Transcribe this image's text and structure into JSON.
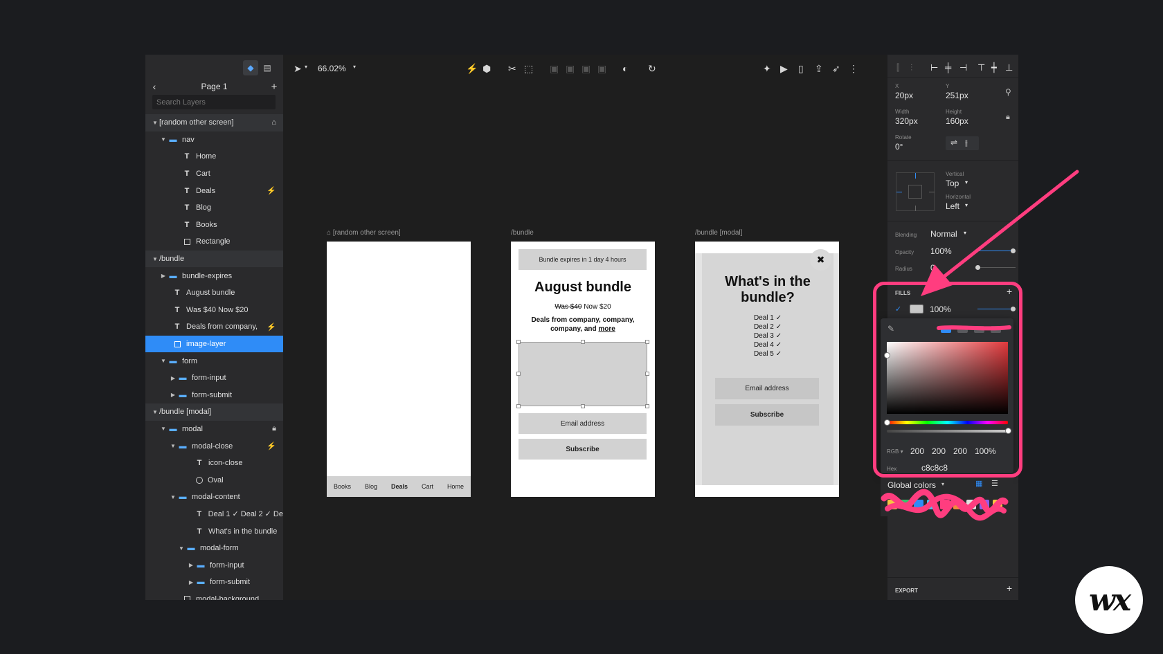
{
  "layers_panel": {
    "page_title": "Page 1",
    "search_placeholder": "Search Layers",
    "items": [
      {
        "label": "[random other screen]",
        "type": "section"
      },
      {
        "label": "nav",
        "type": "folder"
      },
      {
        "label": "Home",
        "type": "text"
      },
      {
        "label": "Cart",
        "type": "text"
      },
      {
        "label": "Deals",
        "type": "text"
      },
      {
        "label": "Blog",
        "type": "text"
      },
      {
        "label": "Books",
        "type": "text"
      },
      {
        "label": "Rectangle",
        "type": "rect"
      },
      {
        "label": "/bundle",
        "type": "section"
      },
      {
        "label": "bundle-expires",
        "type": "folder"
      },
      {
        "label": "August bundle",
        "type": "text"
      },
      {
        "label": "Was $40 Now $20",
        "type": "text"
      },
      {
        "label": "Deals from company,",
        "type": "text"
      },
      {
        "label": "image-layer",
        "type": "rect"
      },
      {
        "label": "form",
        "type": "folder"
      },
      {
        "label": "form-input",
        "type": "folder"
      },
      {
        "label": "form-submit",
        "type": "folder"
      },
      {
        "label": "/bundle [modal]",
        "type": "section"
      },
      {
        "label": "modal",
        "type": "folder"
      },
      {
        "label": "modal-close",
        "type": "folder"
      },
      {
        "label": "icon-close",
        "type": "text"
      },
      {
        "label": "Oval",
        "type": "oval"
      },
      {
        "label": "modal-content",
        "type": "folder"
      },
      {
        "label": "Deal 1 ✓ Deal 2 ✓ De",
        "type": "text"
      },
      {
        "label": "What's in the bundle",
        "type": "text"
      },
      {
        "label": "modal-form",
        "type": "folder"
      },
      {
        "label": "form-input",
        "type": "folder"
      },
      {
        "label": "form-submit",
        "type": "folder"
      },
      {
        "label": "modal-background",
        "type": "rect"
      }
    ]
  },
  "toolbar": {
    "zoom": "66.02%"
  },
  "canvas": {
    "artboard_1": {
      "label": "[random other screen]",
      "nav": [
        "Books",
        "Blog",
        "Deals",
        "Cart",
        "Home"
      ]
    },
    "artboard_2": {
      "label": "/bundle",
      "expires": "Bundle expires in 1 day 4 hours",
      "title": "August bundle",
      "was": "Was $40",
      "now": "Now $20",
      "deals_line1": "Deals from company, company,",
      "deals_line2": "company, and",
      "more": "more",
      "email_placeholder": "Email address",
      "subscribe": "Subscribe"
    },
    "artboard_3": {
      "label": "/bundle [modal]",
      "close": "✖",
      "title_line1": "What's in the",
      "title_line2": "bundle?",
      "deals": [
        "Deal 1 ✓",
        "Deal 2 ✓",
        "Deal 3 ✓",
        "Deal 4 ✓",
        "Deal 5 ✓"
      ],
      "email_placeholder": "Email address",
      "subscribe": "Subscribe"
    }
  },
  "inspector": {
    "x_label": "X",
    "x_value": "20px",
    "y_label": "Y",
    "y_value": "251px",
    "width_label": "Width",
    "width_value": "320px",
    "height_label": "Height",
    "height_value": "160px",
    "rotate_label": "Rotate",
    "rotate_value": "0°",
    "vertical_label": "Vertical",
    "vertical_value": "Top",
    "horizontal_label": "Horizontal",
    "horizontal_value": "Left",
    "blending_label": "Blending",
    "blending_value": "Normal",
    "opacity_label": "Opacity",
    "opacity_value": "100%",
    "radius_label": "Radius",
    "radius_value": "0",
    "fills_label": "FILLS",
    "fill_opacity": "100%",
    "fill_color": "#c8c8c8",
    "export_label": "EXPORT"
  },
  "color_picker": {
    "mode": "RGB",
    "r": "200",
    "g": "200",
    "b": "200",
    "a": "100%",
    "hex_label": "Hex",
    "hex_value": "c8c8c8"
  },
  "global_colors": {
    "label": "Global colors",
    "swatches": [
      "#f6c343",
      "#35c46b",
      "#2f8cf7",
      "#46c1f0",
      "#ff3d7f",
      "#f08a3c",
      "#e2e2e2",
      "#8e5cf0",
      "#f6c343"
    ]
  },
  "annotation_color": "#ff3d7f",
  "logo": "wx"
}
